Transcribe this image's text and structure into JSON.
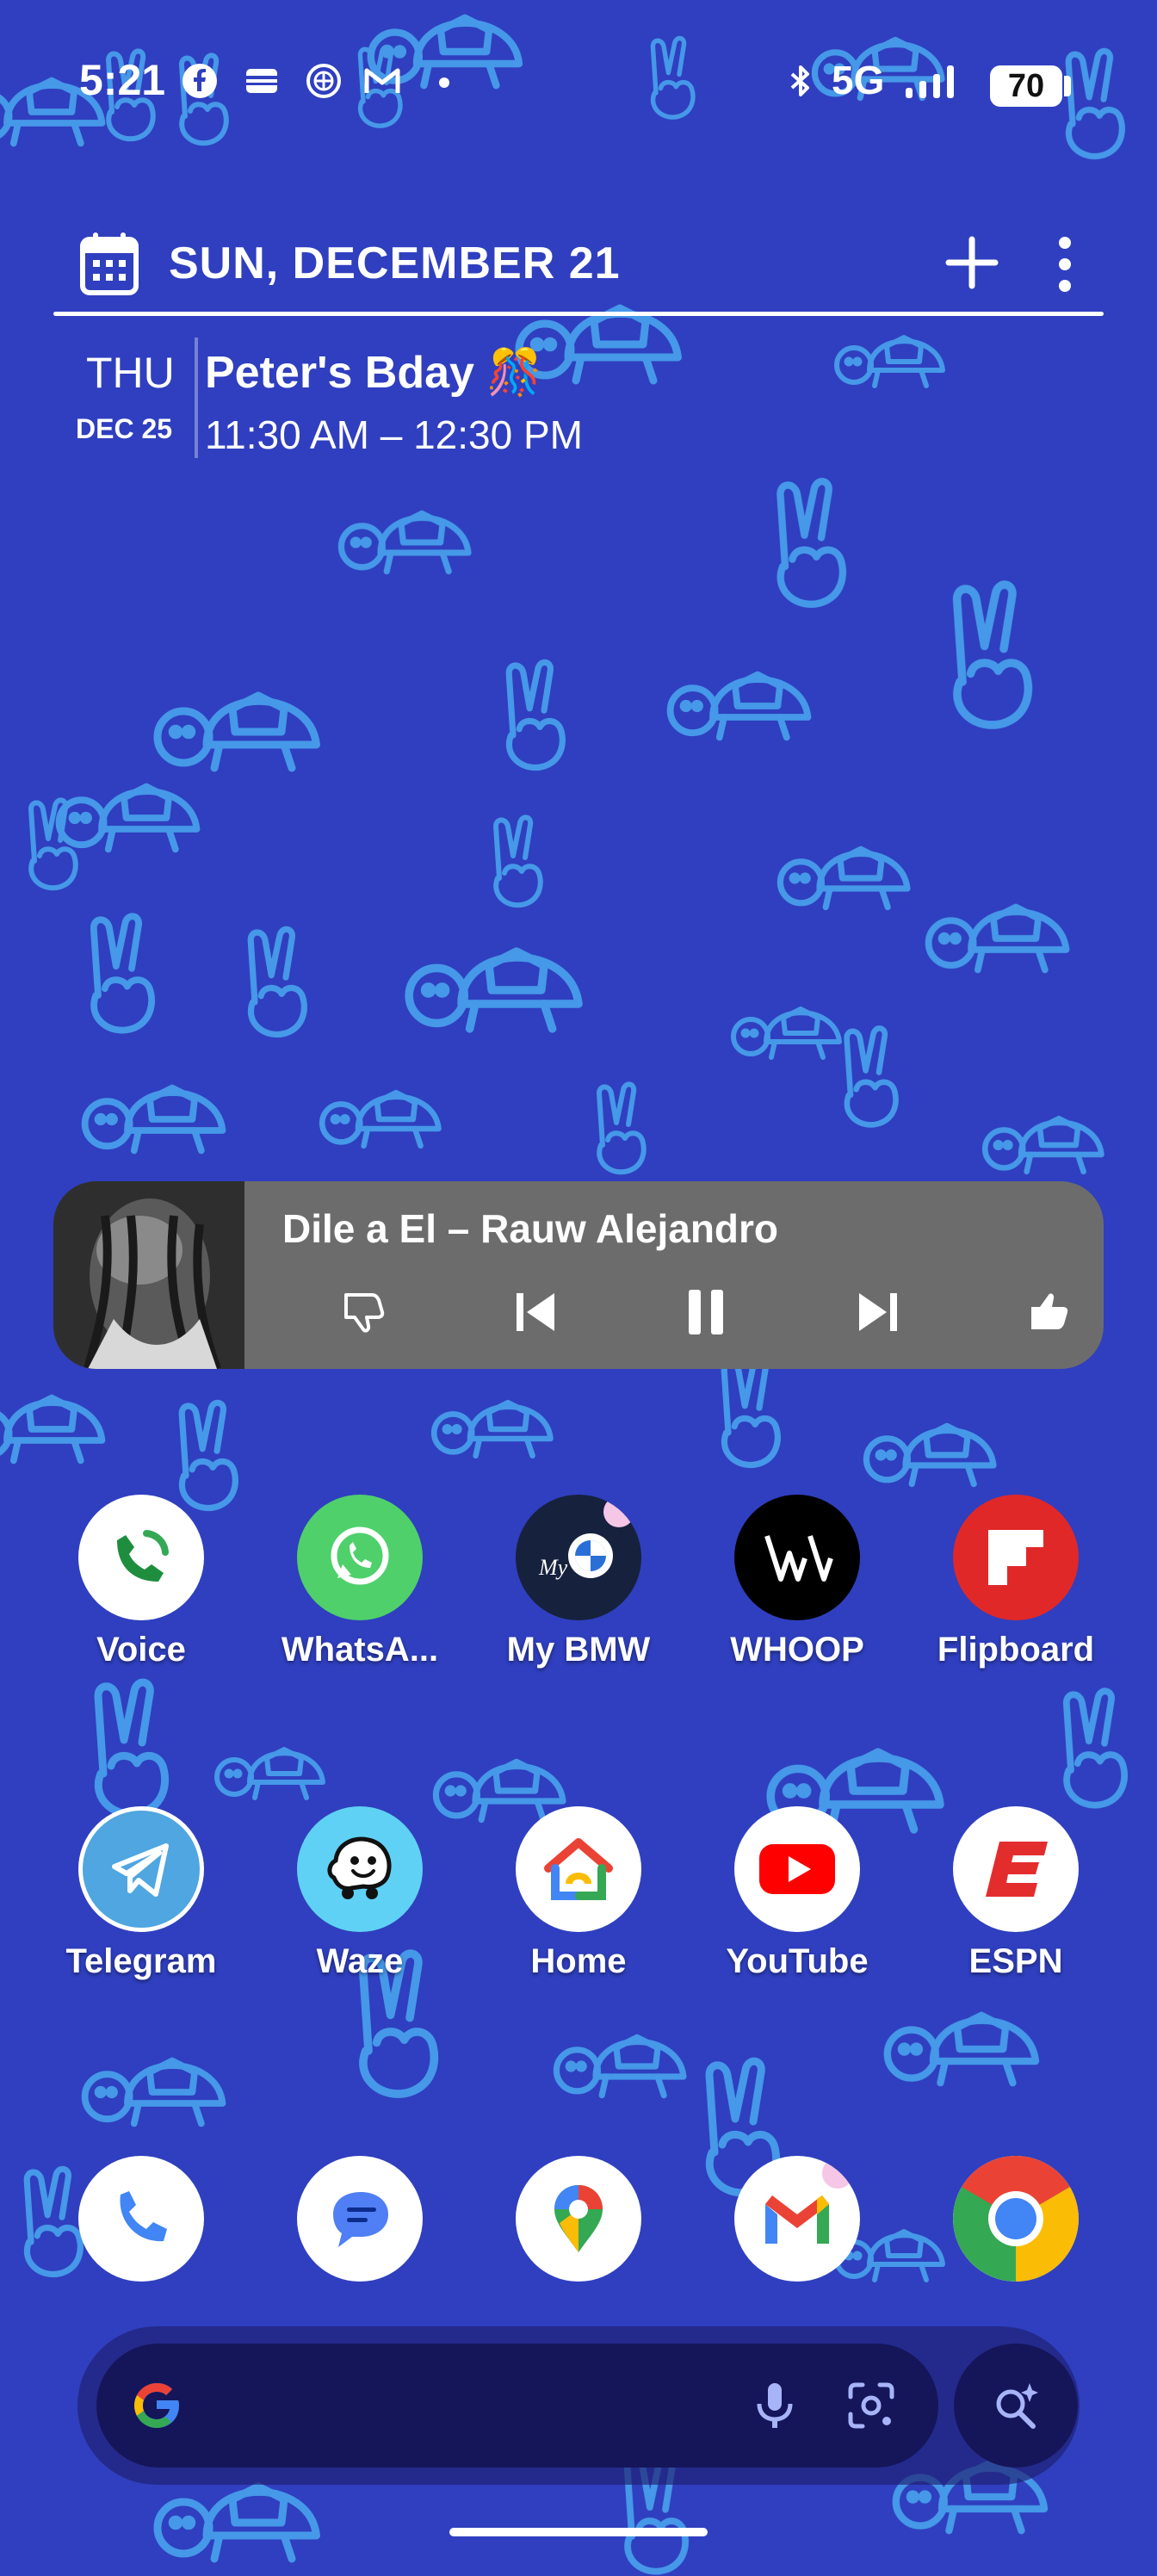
{
  "status_bar": {
    "time": "5:21",
    "network": "5G",
    "battery": "70",
    "icons": [
      "facebook-icon",
      "wallet-icon",
      "bmw-icon",
      "gmail-icon",
      "dot-icon",
      "bluetooth-icon",
      "signal-icon"
    ]
  },
  "calendar_widget": {
    "header_date": "SUN, DECEMBER 21",
    "events": [
      {
        "day": "THU",
        "date": "DEC 25",
        "title": "Peter's Bday 🎊",
        "time": "11:30 AM – 12:30 PM"
      }
    ]
  },
  "media_widget": {
    "track": "Dile a El – Rauw Alejandro",
    "controls": [
      "thumbs-down-icon",
      "previous-icon",
      "pause-icon",
      "next-icon",
      "thumbs-up-icon"
    ]
  },
  "apps": {
    "row1": [
      {
        "label": "Voice",
        "icon": "voice-icon",
        "color": "#ffffff"
      },
      {
        "label": "WhatsA...",
        "icon": "whatsapp-icon",
        "color": "#4fd06b"
      },
      {
        "label": "My BMW",
        "icon": "bmw-icon",
        "color": "#16213d"
      },
      {
        "label": "WHOOP",
        "icon": "whoop-icon",
        "color": "#000000"
      },
      {
        "label": "Flipboard",
        "icon": "flipboard-icon",
        "color": "#e12828"
      }
    ],
    "row2": [
      {
        "label": "Telegram",
        "icon": "telegram-icon",
        "color": "#4fa6e0"
      },
      {
        "label": "Waze",
        "icon": "waze-icon",
        "color": "#5fd1f5"
      },
      {
        "label": "Home",
        "icon": "google-home-icon",
        "color": "#ffffff"
      },
      {
        "label": "YouTube",
        "icon": "youtube-icon",
        "color": "#ffffff"
      },
      {
        "label": "ESPN",
        "icon": "espn-icon",
        "color": "#ffffff"
      }
    ],
    "dock": [
      {
        "icon": "phone-icon"
      },
      {
        "icon": "messages-icon"
      },
      {
        "icon": "maps-icon"
      },
      {
        "icon": "gmail-icon"
      },
      {
        "icon": "chrome-icon"
      }
    ]
  },
  "search_bar": {
    "icons": [
      "google-g-icon",
      "microphone-icon",
      "lens-icon",
      "ai-search-icon"
    ]
  },
  "colors": {
    "wallpaper": "#2f3fbf",
    "wallpaper_pattern": "#4aa3ec"
  }
}
